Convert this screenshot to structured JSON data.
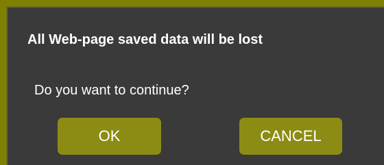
{
  "dialog": {
    "title": "All Web-page saved data will be lost",
    "message": "Do you want to continue?",
    "ok_label": "OK",
    "cancel_label": "CANCEL"
  },
  "colors": {
    "frame": "#808000",
    "dialog_background": "#3a3a3a",
    "button": "#8c8c14",
    "text": "#ffffff"
  }
}
